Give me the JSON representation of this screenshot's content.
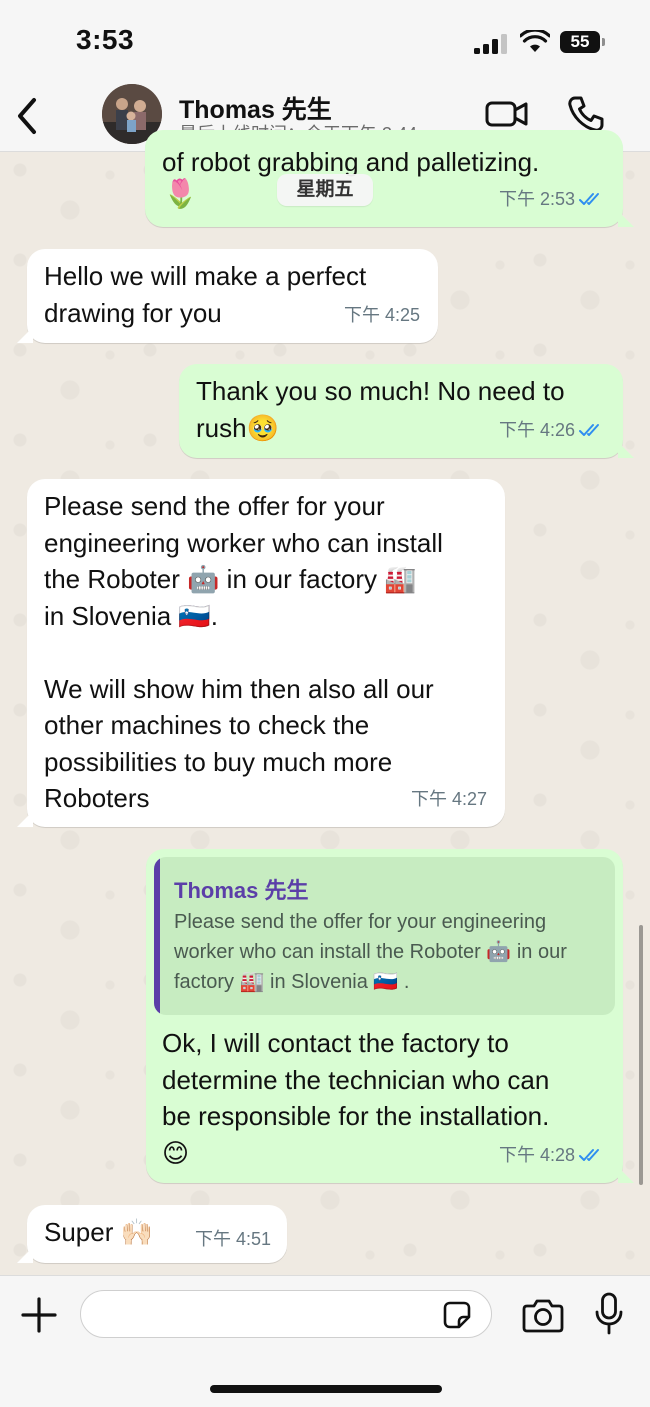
{
  "status_bar": {
    "time": "3:53",
    "battery": "55"
  },
  "header": {
    "back_label": "‹",
    "contact_name": "Thomas 先生",
    "last_seen": "最后上线时间：今天下午 3:44"
  },
  "chat": {
    "date_chip": "星期五",
    "messages": [
      {
        "direction": "out",
        "text": "of robot grabbing and palletizing.",
        "extra": "🌷",
        "time": "下午 2:53",
        "read": true
      },
      {
        "direction": "in",
        "text": "Hello we will make a perfect\ndrawing for you",
        "time": "下午 4:25"
      },
      {
        "direction": "out",
        "text": "Thank you so much! No need to\nrush🥹",
        "time": "下午 4:26",
        "read": true
      },
      {
        "direction": "in",
        "text": "Please send the offer for your\nengineering worker who can install\nthe Roboter 🤖 in our factory 🏭\nin Slovenia 🇸🇮.\n\nWe will show him then also all our\nother machines to check the\npossibilities to buy much more\nRoboters",
        "time": "下午 4:27"
      },
      {
        "direction": "out",
        "quote_author": "Thomas 先生",
        "quote_text": "Please send the offer for your engineering worker who can install the Roboter 🤖 in our factory 🏭 in Slovenia 🇸🇮 .",
        "text": "Ok, I will contact the factory to\ndetermine the technician who can\nbe responsible for the installation.\n😊",
        "time": "下午 4:28",
        "read": true
      },
      {
        "direction": "in",
        "text": "Super 🙌🏻",
        "time": "下午 4:51"
      }
    ]
  },
  "input": {
    "placeholder": ""
  },
  "icons": {
    "back": "chevron-left-icon",
    "video": "video-camera-icon",
    "call": "phone-icon",
    "plus": "plus-icon",
    "sticker": "sticker-icon",
    "camera": "camera-icon",
    "mic": "microphone-icon"
  },
  "colors": {
    "outgoing_bubble": "#d9fdd3",
    "incoming_bubble": "#ffffff",
    "wallpaper": "#efeae2",
    "read_ticks": "#2f8ef0",
    "quote_accent": "#5b3ea8"
  }
}
